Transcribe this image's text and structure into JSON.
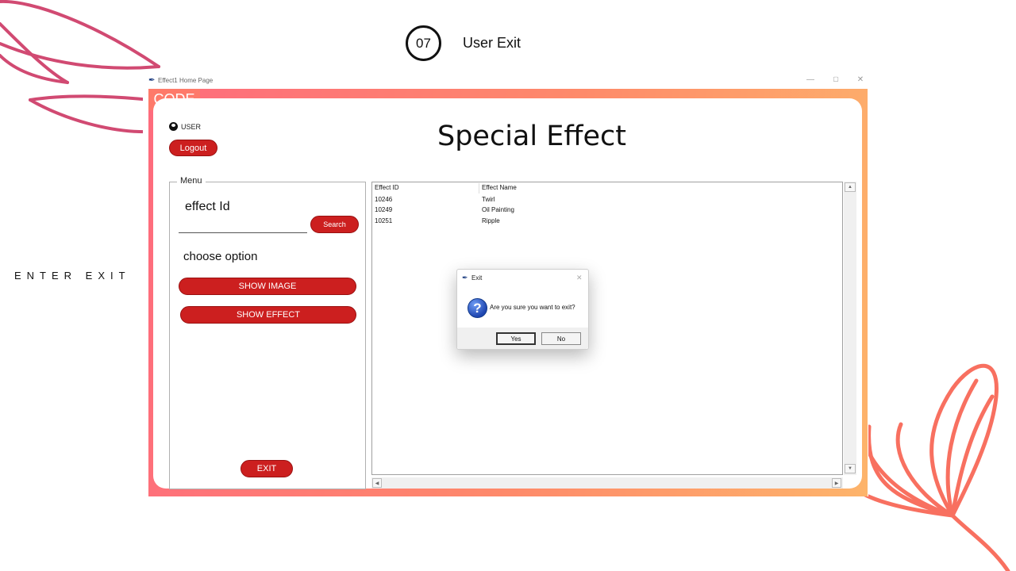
{
  "slide": {
    "step_number": "07",
    "step_title": "User Exit",
    "side_label": "ENTER EXIT",
    "accent_color": "#fe7a6a",
    "leaf_color": "#d14a72",
    "flower_color": "#f87060"
  },
  "window": {
    "title": "Effect1 Home Page",
    "feather_icon": "feather-icon",
    "minimize_glyph": "—",
    "maximize_glyph": "▢",
    "close_glyph": "✕"
  },
  "app": {
    "code_tag": "CODE",
    "user_label": "USER",
    "logout_label": "Logout",
    "title": "Special Effect",
    "button_color": "#cc1f1f"
  },
  "menu": {
    "legend": "Menu",
    "effect_id_label": "effect Id",
    "effect_id_value": "",
    "search_label": "Search",
    "choose_option_label": "choose option",
    "show_image_label": "SHOW IMAGE",
    "show_effect_label": "SHOW EFFECT",
    "exit_label": "EXIT"
  },
  "table": {
    "columns": [
      "Effect ID",
      "Effect Name"
    ],
    "rows": [
      [
        "10246",
        "Twirl"
      ],
      [
        "10249",
        "Oil Painting"
      ],
      [
        "10251",
        "Ripple"
      ]
    ]
  },
  "dialog": {
    "title": "Exit",
    "message": "Are you sure you want to exit?",
    "close_glyph": "✕",
    "icon_glyph": "?",
    "yes_label": "Yes",
    "no_label": "No"
  }
}
